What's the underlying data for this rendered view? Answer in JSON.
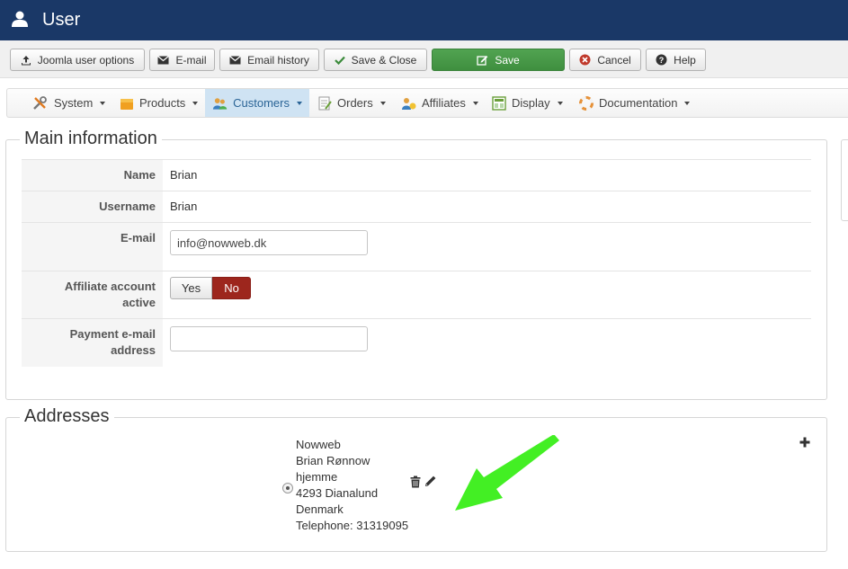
{
  "header": {
    "title": "User",
    "icon": "user-icon"
  },
  "toolbar": {
    "joomla_options": "Joomla user options",
    "email": "E-mail",
    "email_history": "Email history",
    "save_close": "Save & Close",
    "save": "Save",
    "cancel": "Cancel",
    "help": "Help"
  },
  "menu": {
    "items": [
      {
        "label": "System",
        "icon": "wrench-icon"
      },
      {
        "label": "Products",
        "icon": "box-icon"
      },
      {
        "label": "Customers",
        "icon": "customers-icon",
        "active": true
      },
      {
        "label": "Orders",
        "icon": "orders-icon"
      },
      {
        "label": "Affiliates",
        "icon": "affiliates-icon"
      },
      {
        "label": "Display",
        "icon": "display-icon"
      },
      {
        "label": "Documentation",
        "icon": "lifebuoy-icon"
      }
    ]
  },
  "main_info": {
    "legend": "Main information",
    "name_label": "Name",
    "name_value": "Brian",
    "username_label": "Username",
    "username_value": "Brian",
    "email_label": "E-mail",
    "email_value": "info@nowweb.dk",
    "affiliate_label_line1": "Affiliate account",
    "affiliate_label_line2": "active",
    "affiliate_yes": "Yes",
    "affiliate_no": "No",
    "payment_label_line1": "Payment e-mail",
    "payment_label_line2": "address",
    "payment_value": ""
  },
  "addresses": {
    "legend": "Addresses",
    "lines": [
      "Nowweb",
      "Brian Rønnow",
      "hjemme",
      "4293 Dianalund",
      "Denmark",
      "Telephone: 31319095"
    ]
  },
  "colors": {
    "header_bg": "#1a3867",
    "save_green": "#46a046",
    "no_red": "#9d261d",
    "active_menu": "#cfe3f3",
    "arrow_green": "#33ee11"
  }
}
